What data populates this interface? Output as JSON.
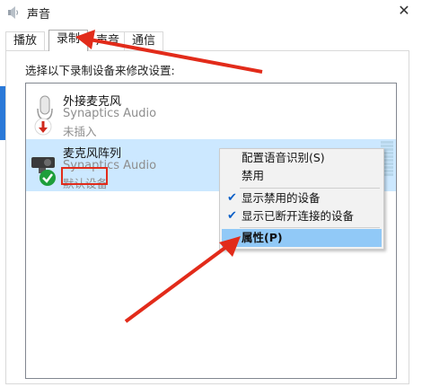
{
  "window": {
    "title": "声音",
    "close_glyph": "✕"
  },
  "tabs": [
    {
      "label": "播放"
    },
    {
      "label": "录制",
      "active": true
    },
    {
      "label": "声音"
    },
    {
      "label": "通信"
    }
  ],
  "instruction": "选择以下录制设备来修改设置:",
  "devices": [
    {
      "name": "外接麦克风",
      "driver": "Synaptics Audio",
      "status": "未插入",
      "icon": "microphone-icon",
      "badge": "unplugged-down-arrow-icon"
    },
    {
      "name": "麦克风阵列",
      "driver": "Synaptics Audio",
      "status": "默认设备",
      "icon": "webcam-microphone-icon",
      "badge": "default-checkmark-icon",
      "selected": true
    }
  ],
  "context_menu": {
    "items": [
      {
        "label": "配置语音识别(S)"
      },
      {
        "label": "禁用"
      },
      {
        "label": "显示禁用的设备",
        "checked": true
      },
      {
        "label": "显示已断开连接的设备",
        "checked": true
      },
      {
        "label": "属性(P)",
        "hover": true
      }
    ],
    "check_glyph": "✔"
  },
  "colors": {
    "selection": "#cce8ff",
    "menu_hover": "#91c9f7",
    "annotation_red": "#e22b1a",
    "default_badge": "#1e9e3a"
  }
}
